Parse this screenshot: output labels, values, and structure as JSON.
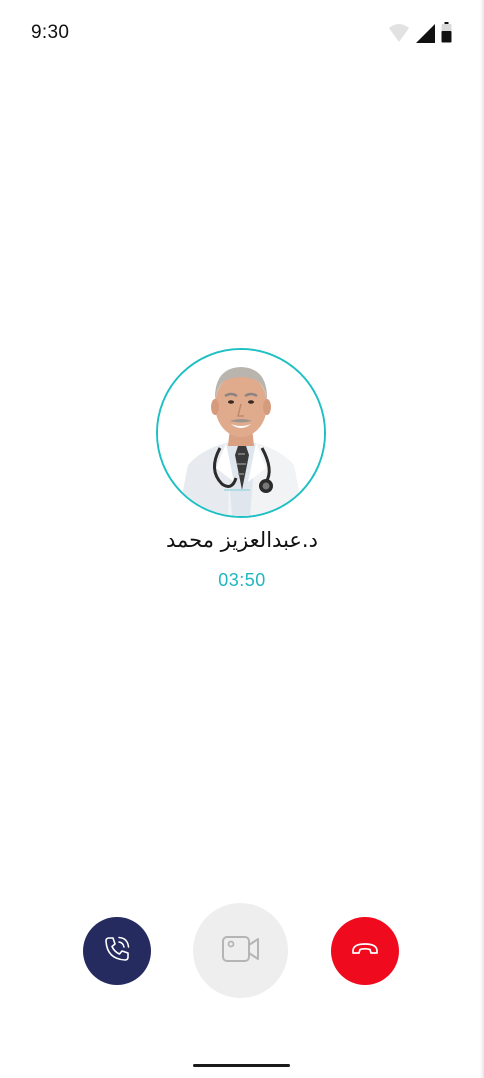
{
  "status_bar": {
    "time": "9:30",
    "icons": [
      "wifi-icon",
      "signal-icon",
      "battery-icon"
    ]
  },
  "caller": {
    "name": "د.عبدالعزيز محمد",
    "duration": "03:50"
  },
  "controls": {
    "phone": "phone-icon",
    "video": "video-camera-icon",
    "end_call": "hang-up-icon"
  },
  "colors": {
    "accent": "#1fc0c4",
    "timer": "#1fb6c0",
    "phone_button": "#252a5f",
    "video_button": "#eeeeee",
    "end_button": "#ef0a1e"
  }
}
